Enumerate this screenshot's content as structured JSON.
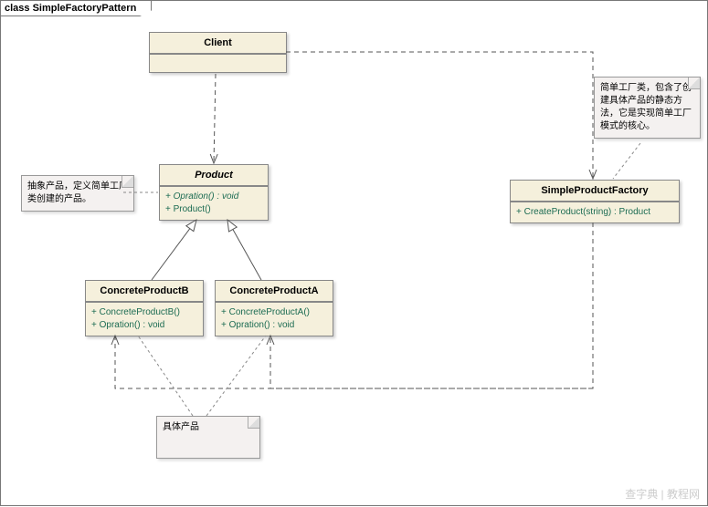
{
  "frame_title": "class SimpleFactoryPattern",
  "client": {
    "name": "Client"
  },
  "product": {
    "name": "Product",
    "ops": [
      "+  Opration() : void",
      "+  Product()"
    ],
    "abstract": true
  },
  "factory": {
    "name": "SimpleProductFactory",
    "ops": [
      "+  CreateProduct(string) : Product"
    ]
  },
  "concreteA": {
    "name": "ConcreteProductA",
    "ops": [
      "+  ConcreteProductA()",
      "+  Opration() : void"
    ]
  },
  "concreteB": {
    "name": "ConcreteProductB",
    "ops": [
      "+  ConcreteProductB()",
      "+  Opration() : void"
    ]
  },
  "note_abstract": "抽象产品，定义简单工厂类创建的产品。",
  "note_factory": "简单工厂类，包含了创建具体产品的静态方法，它是实现简单工厂模式的核心。",
  "note_concrete": "具体产品",
  "watermark": "查字典 | 教程网",
  "chart_data": {
    "type": "uml-class-diagram",
    "title": "SimpleFactoryPattern",
    "classes": [
      {
        "name": "Client",
        "abstract": false,
        "operations": []
      },
      {
        "name": "Product",
        "abstract": true,
        "operations": [
          "+ Opration() : void",
          "+ Product()"
        ]
      },
      {
        "name": "SimpleProductFactory",
        "abstract": false,
        "operations": [
          "+ CreateProduct(string) : Product"
        ]
      },
      {
        "name": "ConcreteProductA",
        "abstract": false,
        "operations": [
          "+ ConcreteProductA()",
          "+ Opration() : void"
        ]
      },
      {
        "name": "ConcreteProductB",
        "abstract": false,
        "operations": [
          "+ ConcreteProductB()",
          "+ Opration() : void"
        ]
      }
    ],
    "relationships": [
      {
        "from": "Client",
        "to": "Product",
        "type": "dependency"
      },
      {
        "from": "Client",
        "to": "SimpleProductFactory",
        "type": "dependency"
      },
      {
        "from": "ConcreteProductA",
        "to": "Product",
        "type": "generalization"
      },
      {
        "from": "ConcreteProductB",
        "to": "Product",
        "type": "generalization"
      },
      {
        "from": "SimpleProductFactory",
        "to": "ConcreteProductA",
        "type": "dependency"
      },
      {
        "from": "SimpleProductFactory",
        "to": "ConcreteProductB",
        "type": "dependency"
      }
    ],
    "notes": [
      {
        "text": "抽象产品，定义简单工厂类创建的产品。",
        "attached_to": "Product"
      },
      {
        "text": "简单工厂类，包含了创建具体产品的静态方法，它是实现简单工厂模式的核心。",
        "attached_to": "SimpleProductFactory"
      },
      {
        "text": "具体产品",
        "attached_to": [
          "ConcreteProductA",
          "ConcreteProductB"
        ]
      }
    ]
  }
}
